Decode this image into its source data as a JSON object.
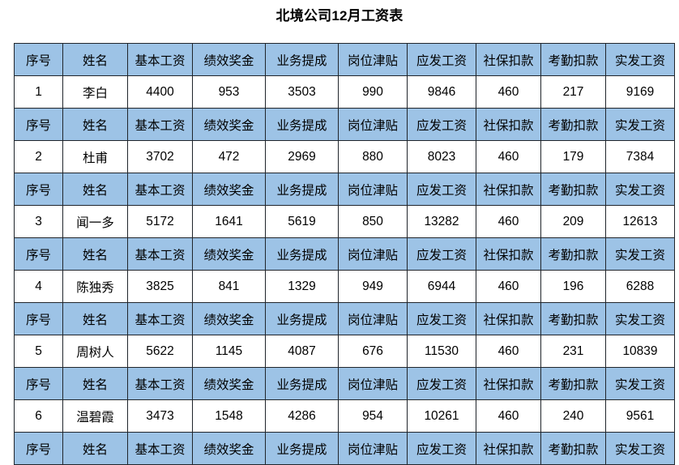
{
  "title": "北境公司12月工资表",
  "table": {
    "columns": [
      "序号",
      "姓名",
      "基本工资",
      "绩效奖金",
      "业务提成",
      "岗位津贴",
      "应发工资",
      "社保扣款",
      "考勤扣款",
      "实发工资"
    ],
    "header_repeats_before_each_row": true,
    "header_repeats_at_end": true,
    "header_bg_color": "#9DC3E6",
    "border_color": "#20252B",
    "rows": [
      {
        "序号": "1",
        "姓名": "李白",
        "基本工资": "4400",
        "绩效奖金": "953",
        "业务提成": "3503",
        "岗位津贴": "990",
        "应发工资": "9846",
        "社保扣款": "460",
        "考勤扣款": "217",
        "实发工资": "9169"
      },
      {
        "序号": "2",
        "姓名": "杜甫",
        "基本工资": "3702",
        "绩效奖金": "472",
        "业务提成": "2969",
        "岗位津贴": "880",
        "应发工资": "8023",
        "社保扣款": "460",
        "考勤扣款": "179",
        "实发工资": "7384"
      },
      {
        "序号": "3",
        "姓名": "闻一多",
        "基本工资": "5172",
        "绩效奖金": "1641",
        "业务提成": "5619",
        "岗位津贴": "850",
        "应发工资": "13282",
        "社保扣款": "460",
        "考勤扣款": "209",
        "实发工资": "12613"
      },
      {
        "序号": "4",
        "姓名": "陈独秀",
        "基本工资": "3825",
        "绩效奖金": "841",
        "业务提成": "1329",
        "岗位津贴": "949",
        "应发工资": "6944",
        "社保扣款": "460",
        "考勤扣款": "196",
        "实发工资": "6288"
      },
      {
        "序号": "5",
        "姓名": "周树人",
        "基本工资": "5622",
        "绩效奖金": "1145",
        "业务提成": "4087",
        "岗位津贴": "676",
        "应发工资": "11530",
        "社保扣款": "460",
        "考勤扣款": "231",
        "实发工资": "10839"
      },
      {
        "序号": "6",
        "姓名": "温碧霞",
        "基本工资": "3473",
        "绩效奖金": "1548",
        "业务提成": "4286",
        "岗位津贴": "954",
        "应发工资": "10261",
        "社保扣款": "460",
        "考勤扣款": "240",
        "实发工资": "9561"
      }
    ]
  }
}
